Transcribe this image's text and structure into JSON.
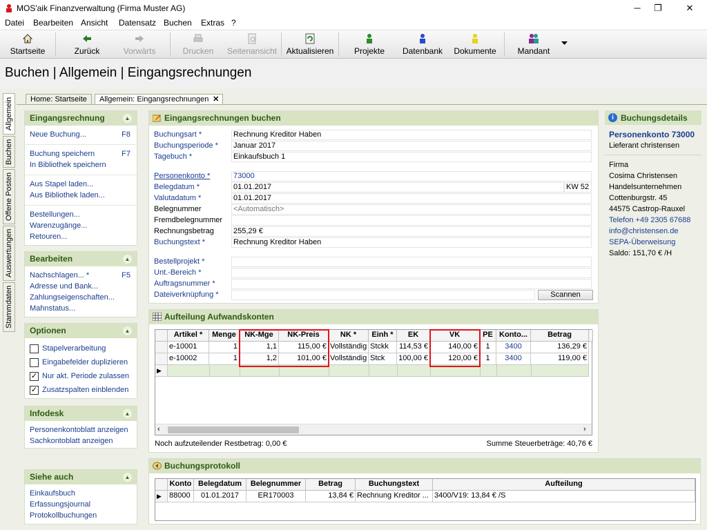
{
  "window": {
    "title": "MOS'aik Finanzverwaltung (Firma Muster AG)",
    "minimize": "─",
    "maximize": "❐",
    "close": "✕"
  },
  "menu": [
    "Datei",
    "Bearbeiten",
    "Ansicht",
    "Datensatz",
    "Buchen",
    "Extras",
    "?"
  ],
  "toolbar": {
    "startseite": "Startseite",
    "zurueck": "Zurück",
    "vorwaerts": "Vorwärts",
    "drucken": "Drucken",
    "seitenansicht": "Seitenansicht",
    "aktualisieren": "Aktualisieren",
    "projekte": "Projekte",
    "datenbank": "Datenbank",
    "dokumente": "Dokumente",
    "mandant": "Mandant"
  },
  "page_header": "Buchen | Allgemein | Eingangsrechnungen",
  "vertical_tabs": [
    "Allgemein",
    "Buchen",
    "Offene Posten",
    "Auswertungen",
    "Stammdaten"
  ],
  "doc_tabs": {
    "home": "Home: Startseite",
    "current": "Allgemein: Eingangsrechnungen"
  },
  "left": {
    "eingangsrechnung": {
      "title": "Eingangsrechnung",
      "neue_buchung": "Neue Buchung...",
      "neue_buchung_key": "F8",
      "speichern": "Buchung speichern",
      "speichern_key": "F7",
      "bibliothek_speichern": "In Bibliothek speichern",
      "stapel_laden": "Aus Stapel laden...",
      "bibliothek_laden": "Aus Bibliothek laden...",
      "bestellungen": "Bestellungen...",
      "warenzugaenge": "Warenzugänge...",
      "retouren": "Retouren..."
    },
    "bearbeiten": {
      "title": "Bearbeiten",
      "nachschlagen": "Nachschlagen... *",
      "nachschlagen_key": "F5",
      "adresse": "Adresse und Bank...",
      "zahlung": "Zahlungseigenschaften...",
      "mahnstatus": "Mahnstatus..."
    },
    "optionen": {
      "title": "Optionen",
      "items": [
        {
          "label": "Stapelverarbeitung",
          "checked": false
        },
        {
          "label": "Eingabefelder duplizieren",
          "checked": false
        },
        {
          "label": "Nur akt. Periode zulassen",
          "checked": true
        },
        {
          "label": "Zusatzspalten einblenden",
          "checked": true
        }
      ]
    },
    "infodesk": {
      "title": "Infodesk",
      "personenkonto": "Personenkontoblatt anzeigen",
      "sachkonto": "Sachkontoblatt anzeigen"
    },
    "siehe_auch": {
      "title": "Siehe auch",
      "einkaufsbuch": "Einkaufsbuch",
      "erfassungsjournal": "Erfassungsjournal",
      "protokollbuchungen": "Protokollbuchungen"
    }
  },
  "form": {
    "title": "Eingangsrechnungen buchen",
    "buchungsart_label": "Buchungsart *",
    "buchungsart": "Rechnung Kreditor Haben",
    "buchungsperiode_label": "Buchungsperiode *",
    "buchungsperiode": "Januar 2017",
    "tagebuch_label": "Tagebuch *",
    "tagebuch": "Einkaufsbuch 1",
    "personenkonto_label": "Personenkonto *",
    "personenkonto": "73000",
    "belegdatum_label": "Belegdatum *",
    "belegdatum": "01.01.2017",
    "kw": "KW 52",
    "valutadatum_label": "Valutadatum *",
    "valutadatum": "01.01.2017",
    "belegnummer_label": "Belegnummer",
    "belegnummer": "<Automatisch>",
    "fremdbelegnummer_label": "Fremdbelegnummer",
    "fremdbelegnummer": "",
    "rechnungsbetrag_label": "Rechnungsbetrag",
    "rechnungsbetrag": "255,29 €",
    "buchungstext_label": "Buchungstext *",
    "buchungstext": "Rechnung Kreditor Haben",
    "bestellprojekt_label": "Bestellprojekt *",
    "unt_bereich_label": "Unt.-Bereich *",
    "auftragsnummer_label": "Auftragsnummer *",
    "dateiverknuepfung_label": "Dateiverknüpfung *",
    "scannen": "Scannen"
  },
  "aufteilung": {
    "title": "Aufteilung Aufwandskonten",
    "columns": [
      "Artikel *",
      "Menge",
      "NK-Mge",
      "NK-Preis",
      "NK *",
      "Einh *",
      "EK",
      "VK",
      "PE",
      "Konto...",
      "Betrag"
    ],
    "rows": [
      [
        "e-10001",
        "1",
        "1,1",
        "115,00 €",
        "Vollständig",
        "Stckk",
        "114,53 €",
        "140,00 €",
        "1",
        "3400",
        "136,29 €"
      ],
      [
        "e-10002",
        "1",
        "1,2",
        "101,00 €",
        "Vollständig",
        "Stck",
        "100,00 €",
        "120,00 €",
        "1",
        "3400",
        "119,00 €"
      ]
    ],
    "restbetrag": "Noch aufzuteilender Restbetrag: 0,00 €",
    "steuer": "Summe Steuerbeträge: 40,76 €"
  },
  "protokoll": {
    "title": "Buchungsprotokoll",
    "columns": [
      "Konto",
      "Belegdatum",
      "Belegnummer",
      "Betrag",
      "Buchungstext",
      "Aufteilung"
    ],
    "rows": [
      [
        "88000",
        "01.01.2017",
        "ER170003",
        "13,84 €",
        "Rechnung Kreditor ...",
        "3400/V19: 13,84 € /S"
      ]
    ]
  },
  "details": {
    "title": "Buchungsdetails",
    "konto": "Personenkonto 73000",
    "typ": "Lieferant christensen",
    "firma": "Firma",
    "name": "Cosima Christensen",
    "unternehmen": "Handelsunternehmen",
    "strasse": "Cottenburgstr. 45",
    "ort": "44575 Castrop-Rauxel",
    "telefon": "Telefon +49 2305 67688",
    "email": "info@christensen.de",
    "zahlung": "SEPA-Überweisung",
    "saldo": "Saldo: 151,70 € /H"
  },
  "colors": {
    "accent": "#2d5a13",
    "link": "#1a3c8e",
    "highlight": "#e0141c",
    "header_bg": "#d8e3c4"
  }
}
